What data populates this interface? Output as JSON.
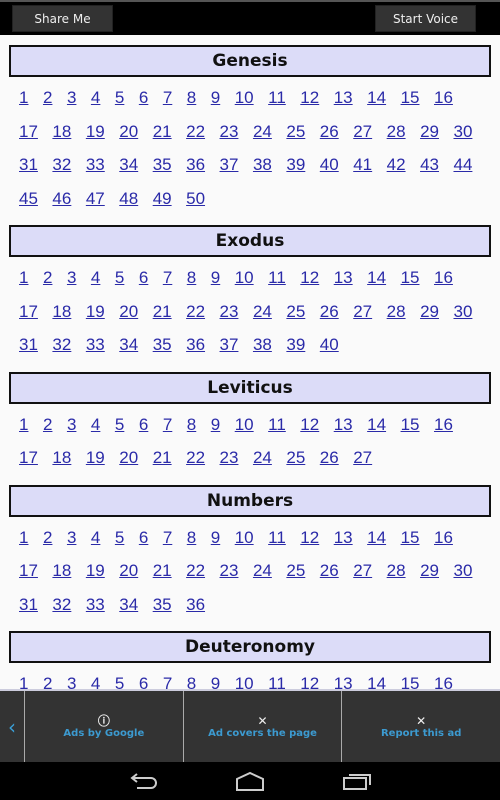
{
  "toolbar": {
    "share_label": "Share Me",
    "voice_label": "Start Voice"
  },
  "books": [
    {
      "name": "Genesis",
      "chapters": [
        "1",
        "2",
        "3",
        "4",
        "5",
        "6",
        "7",
        "8",
        "9",
        "10",
        "11",
        "12",
        "13",
        "14",
        "15",
        "16",
        "17",
        "18",
        "19",
        "20",
        "21",
        "22",
        "23",
        "24",
        "25",
        "26",
        "27",
        "28",
        "29",
        "30",
        "31",
        "32",
        "33",
        "34",
        "35",
        "36",
        "37",
        "38",
        "39",
        "40",
        "41",
        "42",
        "43",
        "44",
        "45",
        "46",
        "47",
        "48",
        "49",
        "50"
      ]
    },
    {
      "name": "Exodus",
      "chapters": [
        "1",
        "2",
        "3",
        "4",
        "5",
        "6",
        "7",
        "8",
        "9",
        "10",
        "11",
        "12",
        "13",
        "14",
        "15",
        "16",
        "17",
        "18",
        "19",
        "20",
        "21",
        "22",
        "23",
        "24",
        "25",
        "26",
        "27",
        "28",
        "29",
        "30",
        "31",
        "32",
        "33",
        "34",
        "35",
        "36",
        "37",
        "38",
        "39",
        "40"
      ]
    },
    {
      "name": "Leviticus",
      "chapters": [
        "1",
        "2",
        "3",
        "4",
        "5",
        "6",
        "7",
        "8",
        "9",
        "10",
        "11",
        "12",
        "13",
        "14",
        "15",
        "16",
        "17",
        "18",
        "19",
        "20",
        "21",
        "22",
        "23",
        "24",
        "25",
        "26",
        "27"
      ]
    },
    {
      "name": "Numbers",
      "chapters": [
        "1",
        "2",
        "3",
        "4",
        "5",
        "6",
        "7",
        "8",
        "9",
        "10",
        "11",
        "12",
        "13",
        "14",
        "15",
        "16",
        "17",
        "18",
        "19",
        "20",
        "21",
        "22",
        "23",
        "24",
        "25",
        "26",
        "27",
        "28",
        "29",
        "30",
        "31",
        "32",
        "33",
        "34",
        "35",
        "36"
      ]
    },
    {
      "name": "Deuteronomy",
      "chapters": [
        "1",
        "2",
        "3",
        "4",
        "5",
        "6",
        "7",
        "8",
        "9",
        "10",
        "11",
        "12",
        "13",
        "14",
        "15",
        "16"
      ]
    }
  ],
  "ad": {
    "ads_by": "Ads by Google",
    "covers": "Ad covers the page",
    "report": "Report this ad"
  },
  "colors": {
    "link": "#2a2aa8",
    "header_bg": "#dcdcf8",
    "ad_text": "#3c9ad0"
  }
}
